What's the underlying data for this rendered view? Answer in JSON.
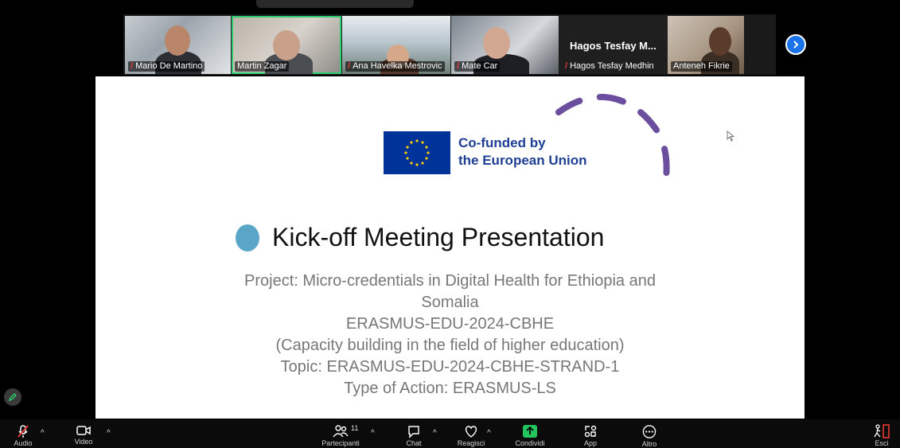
{
  "participants": [
    {
      "name": "Mario De Martino",
      "muted": true
    },
    {
      "name": "Martin Zagar",
      "muted": false,
      "active": true
    },
    {
      "name": "Ana Havelka Mestrovic",
      "muted": true
    },
    {
      "name": "Mate Car",
      "muted": true
    },
    {
      "name": "Hagos Tesfay Medhin",
      "muted": true,
      "display": "Hagos Tesfay M..."
    },
    {
      "name": "Anteneh Fikrie",
      "muted": false
    }
  ],
  "slide": {
    "logo_line1": "Co-funded by",
    "logo_line2": "the European Union",
    "title": "Kick-off Meeting Presentation",
    "lines": [
      "Project: Micro-credentials in Digital Health for Ethiopia and",
      "Somalia",
      "ERASMUS-EDU-2024-CBHE",
      "(Capacity building in the field of higher education)",
      "Topic: ERASMUS-EDU-2024-CBHE-STRAND-1",
      "Type of Action: ERASMUS-LS"
    ]
  },
  "toolbar": {
    "audio": "Audio",
    "video": "Video",
    "participants": "Partecipanti",
    "participants_count": "11",
    "chat": "Chat",
    "reactions": "Reagisci",
    "share": "Condividi",
    "apps": "App",
    "more": "Altro",
    "leave": "Esci"
  },
  "colors": {
    "accent": "#1a73e8",
    "share_green": "#22c55e",
    "eu_blue": "#003399",
    "eu_text": "#1e3f94",
    "title_dot": "#5aa6c8",
    "arc": "#6b4e9e",
    "leave_red": "#e53935"
  }
}
